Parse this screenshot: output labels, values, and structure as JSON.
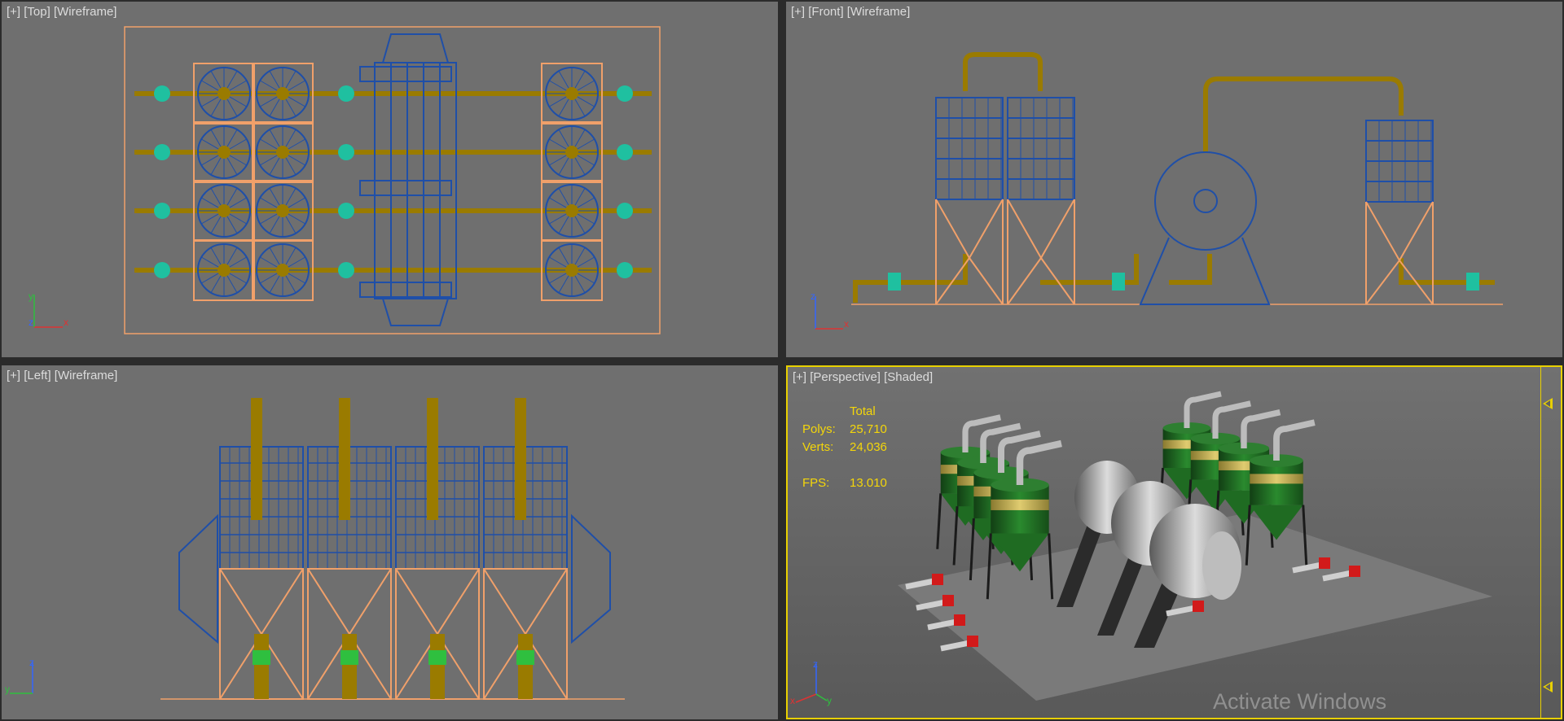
{
  "viewports": {
    "top": {
      "label": "[+] [Top] [Wireframe]"
    },
    "front": {
      "label": "[+] [Front] [Wireframe]"
    },
    "left": {
      "label": "[+] [Left] [Wireframe]"
    },
    "perspective": {
      "label": "[+] [Perspective] [Shaded]"
    }
  },
  "stats": {
    "header": "Total",
    "polys_label": "Polys:",
    "polys_value": "25,710",
    "verts_label": "Verts:",
    "verts_value": "24,036",
    "fps_label": "FPS:",
    "fps_value": "13.010"
  },
  "axes": {
    "x": "x",
    "y": "y",
    "z": "z"
  },
  "watermark": "Activate Windows",
  "colors": {
    "viewport_bg": "#6f6f6f",
    "active_border": "#e8d000",
    "stats_text": "#f4d60a",
    "wire_blue": "#1f4fa8",
    "wire_pipe": "#9a7b00",
    "wire_orange": "#f0a06a",
    "valve_teal": "#1fc0a0",
    "tank_green": "#1f6b22",
    "tank_yellow": "#c9b25a"
  },
  "icons": [
    "axis-tripod-icon",
    "slider-arrow-icon"
  ]
}
